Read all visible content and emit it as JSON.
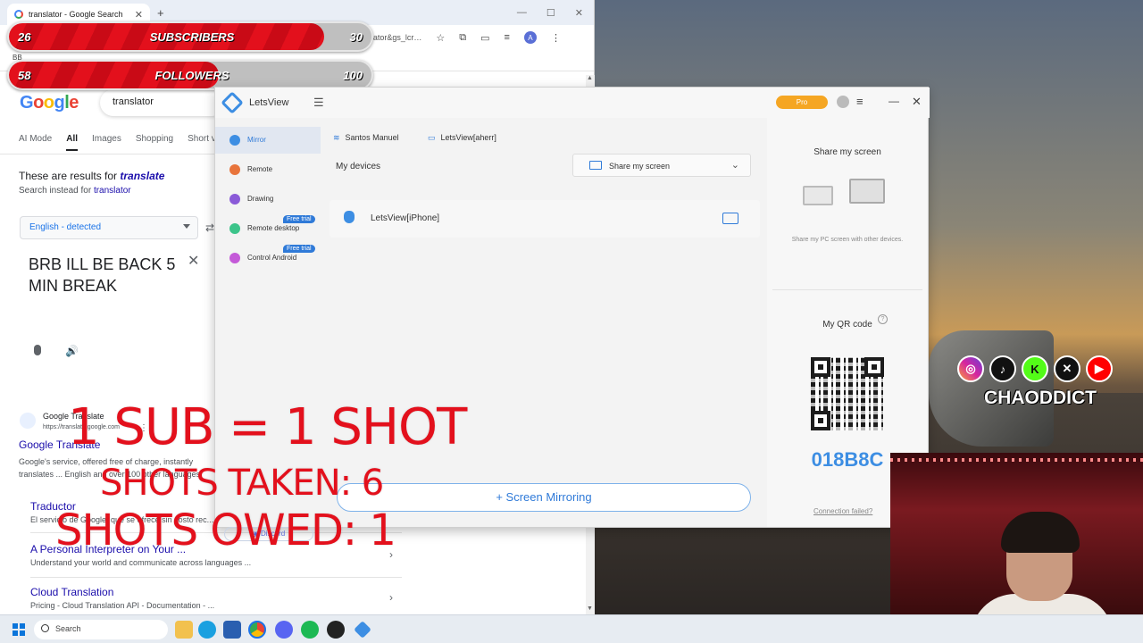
{
  "browser": {
    "tab_title": "translator - Google Search",
    "new_tab": "+",
    "url_fragment": "1170&c…ra islator&gs_lcr…",
    "avatar_letter": "A",
    "bookmark": "BB"
  },
  "google": {
    "logo": [
      "G",
      "o",
      "o",
      "g",
      "l",
      "e"
    ],
    "query": "translator",
    "tabs": [
      "AI Mode",
      "All",
      "Images",
      "Shopping",
      "Short vi"
    ],
    "results_prefix": "These are results for",
    "results_term": "translate",
    "instead_prefix": "Search instead for",
    "instead_term": "translator",
    "source_language": "English - detected",
    "source_text": "BRB ILL BE BACK 5 MIN BREAK",
    "result1": {
      "site": "Google Translate",
      "url": "https://translate.google.com",
      "title": "Google Translate",
      "snippet": "Google's service, offered free of charge, instantly translates ... English and over 100 other languages."
    },
    "subresults": [
      {
        "title": "Traductor",
        "snippet": "El servicio de Google, que se ofrece sin costo rec..."
      },
      {
        "title": "A Personal Interpreter on Your ...",
        "snippet": "Understand your world and communicate across languages ..."
      },
      {
        "title": "Cloud Translation",
        "snippet": "Pricing - Cloud Translation API - Documentation - ..."
      }
    ]
  },
  "overlay_bars": [
    {
      "current": "26",
      "label": "SUBSCRIBERS",
      "goal": "30",
      "progress": 0.87
    },
    {
      "current": "58",
      "label": "FOLLOWERS",
      "goal": "100",
      "progress": 0.58
    }
  ],
  "letsview": {
    "app_name": "LetsView",
    "pro_badge": "Pro",
    "sidebar": [
      {
        "label": "Mirror",
        "color": "#3d8ee3",
        "active": true,
        "badge": ""
      },
      {
        "label": "Remote",
        "color": "#e8743b",
        "active": false,
        "badge": ""
      },
      {
        "label": "Drawing",
        "color": "#8a5ad8",
        "active": false,
        "badge": ""
      },
      {
        "label": "Remote desktop",
        "color": "#3cc48a",
        "active": false,
        "badge": "Free trial"
      },
      {
        "label": "Control Android",
        "color": "#c45ad8",
        "active": false,
        "badge": "Free trial"
      }
    ],
    "discord_label": "Discord",
    "wifi_name": "Santos Manuel",
    "pc_name": "LetsView[aherr]",
    "my_devices": "My devices",
    "share_dropdown": "Share my screen",
    "device_name": "LetsView[iPhone]",
    "mirror_button": "+ Screen Mirroring",
    "share_title": "Share my screen",
    "share_desc": "Share my PC screen with other devices.",
    "qr_title": "My QR code",
    "qr_help": "?",
    "code": "018B8C",
    "connection_failed": "Connection failed?"
  },
  "stream_text": {
    "line1": "1 SUB = 1 SHOT",
    "line2": "SHOTS TAKEN: 6",
    "line3": "SHOTS OWED: 1"
  },
  "social": {
    "icons": [
      "instagram-icon",
      "tiktok-icon",
      "kick-icon",
      "x-icon",
      "youtube-icon"
    ],
    "handle": "CHAODDICT"
  },
  "taskbar": {
    "search_label": "Search"
  },
  "colors": {
    "accent": "#2f7ad8",
    "overlay_red": "#e3101c",
    "google_link": "#1a0dab"
  }
}
